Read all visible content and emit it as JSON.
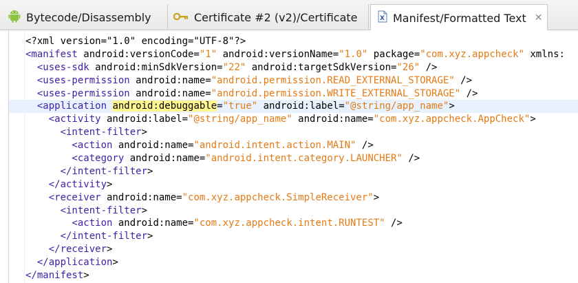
{
  "tabs": [
    {
      "label": "Bytecode/Disassembly",
      "icon": "android-icon",
      "active": false
    },
    {
      "label": "Certificate #2 (v2)/Certificate",
      "icon": "key-icon",
      "active": false
    },
    {
      "label": "Manifest/Formatted Text",
      "icon": "xml-file-icon",
      "active": true,
      "close": "✕"
    }
  ],
  "code": {
    "l1": "<?xml version=\"1.0\" encoding=\"UTF-8\"?>",
    "l2_tag": "<manifest",
    "l2_a1": " android:versionCode=",
    "l2_v1": "\"1\"",
    "l2_a2": " android:versionName=",
    "l2_v2": "\"1.0\"",
    "l2_a3": " package=",
    "l2_v3": "\"com.xyz.appcheck\"",
    "l2_a4": " xmlns:",
    "l3_tag": "  <uses-sdk",
    "l3_a1": " android:minSdkVersion=",
    "l3_v1": "\"22\"",
    "l3_a2": " android:targetSdkVersion=",
    "l3_v2": "\"26\"",
    "l3_end": " />",
    "l4_tag": "  <uses-permission",
    "l4_a1": " android:name=",
    "l4_v1": "\"android.permission.READ_EXTERNAL_STORAGE\"",
    "l4_end": " />",
    "l5_tag": "  <uses-permission",
    "l5_a1": " android:name=",
    "l5_v1": "\"android.permission.WRITE_EXTERNAL_STORAGE\"",
    "l5_end": " />",
    "l6_tag": "  <application",
    "l6_sp": " ",
    "l6_hl": "android:debuggable",
    "l6_eq": "=",
    "l6_v1": "\"true\"",
    "l6_a2": " android:label=",
    "l6_v2": "\"@string/app_name\"",
    "l6_end": ">",
    "l7_tag": "    <activity",
    "l7_a1": " android:label=",
    "l7_v1": "\"@string/app_name\"",
    "l7_a2": " android:name=",
    "l7_v2": "\"com.xyz.appcheck.AppCheck\"",
    "l7_end": ">",
    "l8_tag": "      <intent-filter",
    "l8_end": ">",
    "l9_tag": "        <action",
    "l9_a1": " android:name=",
    "l9_v1": "\"android.intent.action.MAIN\"",
    "l9_end": " />",
    "l10_tag": "        <category",
    "l10_a1": " android:name=",
    "l10_v1": "\"android.intent.category.LAUNCHER\"",
    "l10_end": " />",
    "l11_tag": "      </intent-filter",
    "l11_end": ">",
    "l12_tag": "    </activity",
    "l12_end": ">",
    "l13_tag": "    <receiver",
    "l13_a1": " android:name=",
    "l13_v1": "\"com.xyz.appcheck.SimpleReceiver\"",
    "l13_end": ">",
    "l14_tag": "      <intent-filter",
    "l14_end": ">",
    "l15_tag": "        <action",
    "l15_a1": " android:name=",
    "l15_v1": "\"com.xyz.appcheck.intent.RUNTEST\"",
    "l15_end": " />",
    "l16_tag": "      </intent-filter",
    "l16_end": ">",
    "l17_tag": "    </receiver",
    "l17_end": ">",
    "l18_tag": "  </application",
    "l18_end": ">",
    "l19_tag": "</manifest",
    "l19_end": ">"
  },
  "colors": {
    "tag": "#3f1fa8",
    "value": "#e47a14",
    "highlight": "#fff68f",
    "current_line": "#e8f2fe"
  }
}
